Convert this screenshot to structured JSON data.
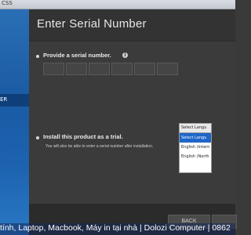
{
  "window": {
    "title_fragment": "CSS"
  },
  "sidebar": {
    "selected_item_label": "ER"
  },
  "header": {
    "title": "Enter Serial Number"
  },
  "serial": {
    "label": "Provide a serial number.",
    "info_icon": "i",
    "boxes": [
      "",
      "",
      "",
      "",
      "",
      ""
    ]
  },
  "trial": {
    "label": "Install this product as a trial.",
    "sublabel": "You will also be able to enter a serial number after installation."
  },
  "language": {
    "selected": "Select Langu",
    "options": [
      "Select Langu",
      "English (Intern",
      "English (North"
    ]
  },
  "buttons": {
    "back": "BACK",
    "next": ""
  },
  "watermark": {
    "text": "tính, Laptop, Macbook, Máy in tại nhà | Dolozi Computer | 0862"
  }
}
